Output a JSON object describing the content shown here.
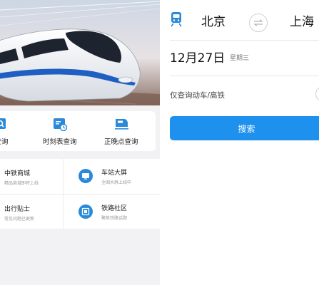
{
  "quick_actions": [
    {
      "label": "查询",
      "icon": "search-icon"
    },
    {
      "label": "时刻表查询",
      "icon": "calendar-clock-icon"
    },
    {
      "label": "正晚点查询",
      "icon": "train-front-icon"
    }
  ],
  "services": [
    {
      "title": "中铁商城",
      "subtitle": "精品商城即将上线",
      "icon": "mall-icon"
    },
    {
      "title": "车站大屏",
      "subtitle": "全国大屏上线中",
      "icon": "station-screen-icon"
    },
    {
      "title": "出行贴士",
      "subtitle": "常见问题已更新",
      "icon": "tips-icon"
    },
    {
      "title": "铁路社区",
      "subtitle": "聚焦铁路话题",
      "icon": "community-icon"
    }
  ],
  "search_form": {
    "from_city": "北京",
    "to_city": "上海",
    "date": "12月27日",
    "weekday": "星期三",
    "filter_label": "仅查询动车/高铁",
    "search_button": "搜索"
  },
  "colors": {
    "accent": "#1e90ee",
    "icon_blue": "#2a8ad9",
    "background": "#f2f2f4"
  }
}
